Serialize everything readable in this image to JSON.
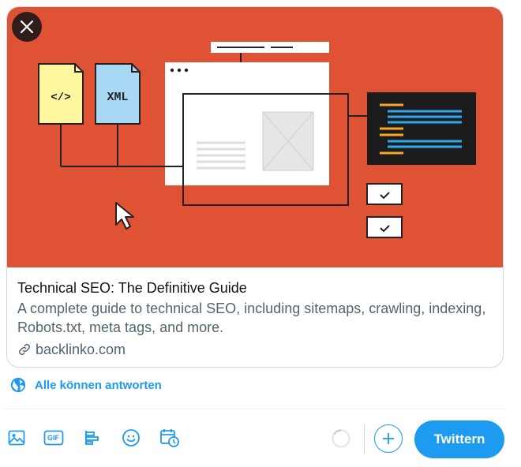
{
  "card": {
    "title": "Technical SEO: The Definitive Guide",
    "description": "A complete guide to technical SEO, including sitemaps, crawling, indexing, Robots.txt, meta tags, and more.",
    "domain": "backlinko.com",
    "image": {
      "background": "#e05234",
      "file_labels": [
        "</>",
        "XML"
      ]
    }
  },
  "reply_setting": {
    "label": "Alle können antworten"
  },
  "toolbar": {
    "icons": [
      "image-icon",
      "gif-icon",
      "poll-icon",
      "emoji-icon",
      "schedule-icon"
    ],
    "gif_label": "GIF",
    "tweet_label": "Twittern"
  },
  "colors": {
    "accent": "#1d9bf0",
    "text": "#0f1419",
    "muted": "#536471",
    "border": "#cfd9de"
  }
}
